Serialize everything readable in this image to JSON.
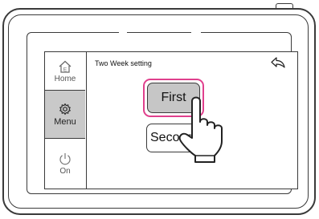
{
  "sidebar": {
    "items": [
      {
        "label": "Home",
        "icon": "home-icon",
        "selected": false
      },
      {
        "label": "Menu",
        "icon": "gear-icon",
        "selected": true
      },
      {
        "label": "On",
        "icon": "power-icon",
        "selected": false
      }
    ]
  },
  "header": {
    "title": "Two Week setting",
    "back_icon": "back-arrow-icon"
  },
  "options": {
    "first_label": "First",
    "second_label": "Second"
  },
  "colors": {
    "highlight": "#e0408d",
    "selected_fill": "#c6c6c6",
    "outline": "#3a3a3a"
  },
  "pointer": {
    "icon": "hand-pointer-icon"
  }
}
